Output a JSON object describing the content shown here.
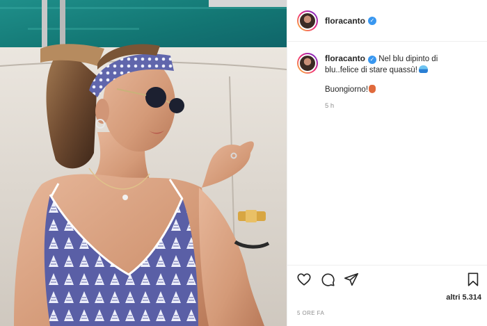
{
  "post": {
    "username": "floracanto",
    "verified_icon": "verified-badge-icon",
    "caption_text": "Nel blu dipinto di blu..felice di stare quassù!",
    "caption_emoji": "water-wave-emoji",
    "caption_second_line": "Buongiorno!",
    "caption_second_emoji": "shield-emoji",
    "comment_time": "5 h",
    "likes_text": "altri 5.314",
    "post_date": "5 ORE FA"
  },
  "actions": {
    "like_icon": "heart-icon",
    "comment_icon": "comment-icon",
    "share_icon": "paper-plane-icon",
    "save_icon": "bookmark-icon"
  },
  "colors": {
    "verified": "#3897f0",
    "text": "#262626",
    "muted": "#8e8e8e",
    "border": "#efefef"
  }
}
